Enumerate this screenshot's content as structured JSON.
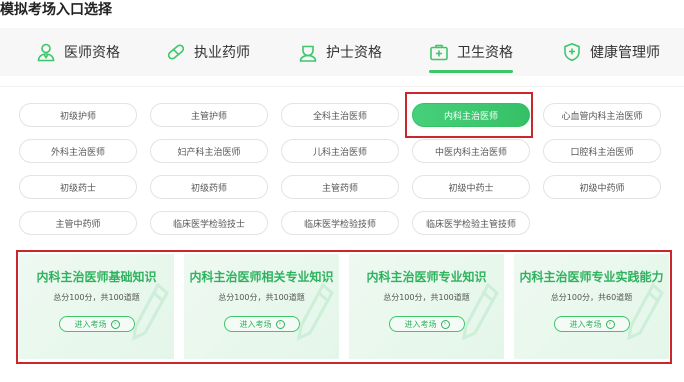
{
  "page": {
    "title": "模拟考场入口选择"
  },
  "nav": {
    "tabs": [
      {
        "label": "医师资格",
        "icon": "doctor-icon",
        "active": false
      },
      {
        "label": "执业药师",
        "icon": "pill-icon",
        "active": false
      },
      {
        "label": "护士资格",
        "icon": "nurse-icon",
        "active": false
      },
      {
        "label": "卫生资格",
        "icon": "medical-kit-icon",
        "active": true
      },
      {
        "label": "健康管理师",
        "icon": "shield-plus-icon",
        "active": false
      }
    ]
  },
  "subjects": [
    "初级护师",
    "主管护师",
    "全科主治医师",
    "内科主治医师",
    "心血管内科主治医师",
    "外科主治医师",
    "妇产科主治医师",
    "儿科主治医师",
    "中医内科主治医师",
    "口腔科主治医师",
    "初级药士",
    "初级药师",
    "主管药师",
    "初级中药士",
    "初级中药师",
    "主管中药师",
    "临床医学检验技士",
    "临床医学检验技师",
    "临床医学检验主管技师"
  ],
  "selected_subject": "内科主治医师",
  "cards": [
    {
      "title": "内科主治医师基础知识",
      "subtitle": "总分100分，共100道题",
      "button": "进入考场"
    },
    {
      "title": "内科主治医师相关专业知识",
      "subtitle": "总分100分，共100道题",
      "button": "进入考场"
    },
    {
      "title": "内科主治医师专业知识",
      "subtitle": "总分100分，共100道题",
      "button": "进入考场"
    },
    {
      "title": "内科主治医师专业实践能力",
      "subtitle": "总分100分，共60道题",
      "button": "进入考场"
    }
  ],
  "colors": {
    "accent": "#3ec66b",
    "highlight": "#c9272b"
  }
}
